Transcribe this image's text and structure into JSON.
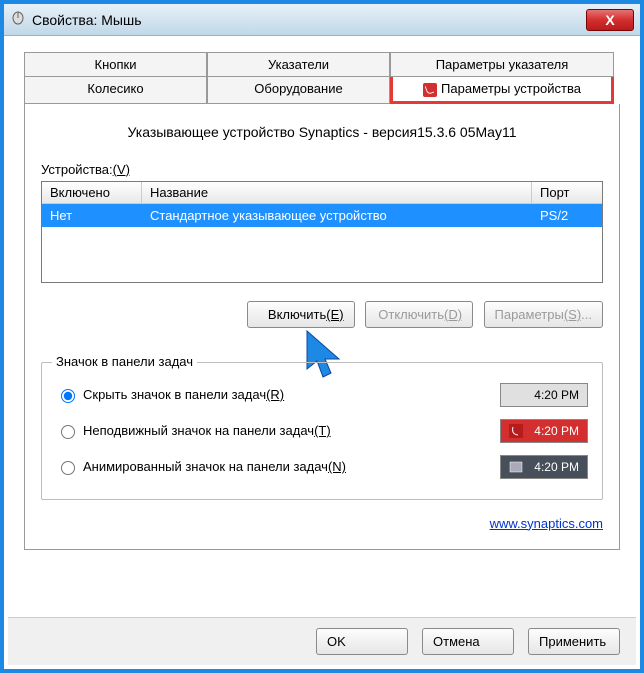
{
  "window": {
    "title": "Свойства: Мышь"
  },
  "tabs": {
    "row1": [
      "Кнопки",
      "Указатели",
      "Параметры указателя"
    ],
    "row2": [
      "Колесико",
      "Оборудование",
      "Параметры устройства"
    ]
  },
  "heading": {
    "text": "Указывающее устройство Synaptics - версия",
    "version": "15.3.6 05May11"
  },
  "devices_label": "Устройства:",
  "devices_key": "(V)",
  "columns": {
    "enabled": "Включено",
    "name": "Название",
    "port": "Порт"
  },
  "row": {
    "enabled": "Нет",
    "name": "Стандартное указывающее устройство",
    "port": "PS/2"
  },
  "buttons": {
    "enable": "Включить",
    "enable_key": "(E)",
    "disable": "Отключить",
    "disable_key": "(D)",
    "params": "Параметры",
    "params_key": "(S)"
  },
  "tray": {
    "group": "Значок в панели задач",
    "opt1": "Скрыть значок в панели задач",
    "opt1_key": "(R)",
    "opt2": "Неподвижный значок на панели задач",
    "opt2_key": "(T)",
    "opt3": "Анимированный значок на панели задач",
    "opt3_key": "(N)",
    "time1": "4:20 PM",
    "time2": "4:20 PM",
    "time3": "4:20 PM"
  },
  "link": "www.synaptics.com",
  "footer": {
    "ok": "OK",
    "cancel": "Отмена",
    "apply": "Применить"
  }
}
